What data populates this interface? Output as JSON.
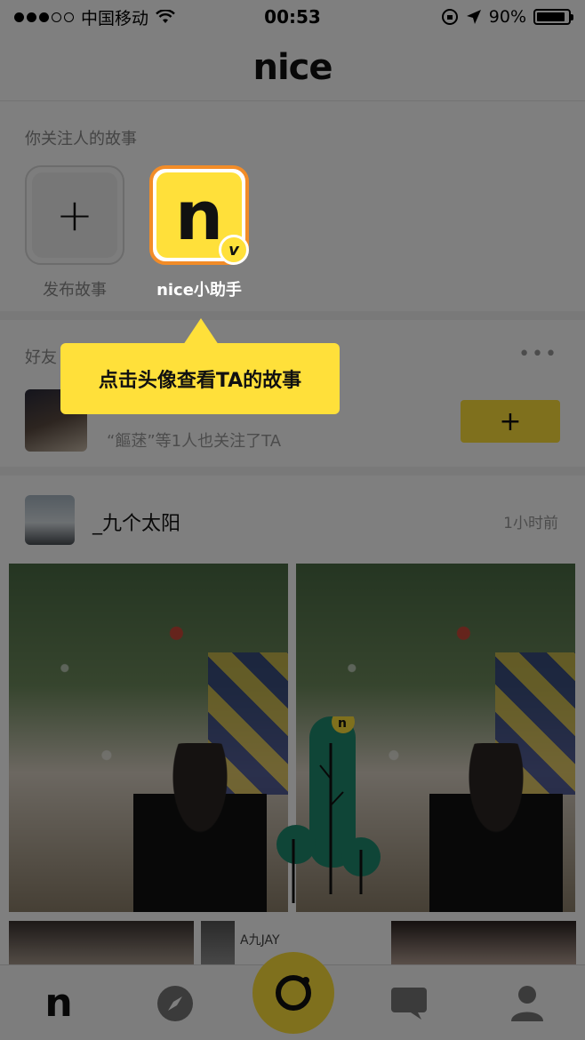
{
  "status_bar": {
    "carrier": "中国移动",
    "time": "00:53",
    "battery": "90%",
    "battery_level": 0.9
  },
  "header": {
    "logo": "nice"
  },
  "stories": {
    "title": "你关注人的故事",
    "items": [
      {
        "label": "发布故事",
        "icon": "plus-icon"
      },
      {
        "label": "nice小助手",
        "icon": "nice-logo-icon",
        "badge": "v"
      }
    ]
  },
  "friends": {
    "title": "好友",
    "more": "•••",
    "suggestion": {
      "name": "_",
      "subtitle": "“饇蒁”等1人也关注了TA",
      "follow_label": "+"
    }
  },
  "post": {
    "username": "_九个太阳",
    "time": "1小时前",
    "preview_text": "A九JAY"
  },
  "tooltip": {
    "text": "点击头像查看TA的故事"
  },
  "tab_bar": {
    "tabs": [
      {
        "name": "home",
        "icon": "nice-home-icon",
        "glyph": "n"
      },
      {
        "name": "discover",
        "icon": "compass-icon"
      },
      {
        "name": "camera",
        "icon": "camera-icon"
      },
      {
        "name": "messages",
        "icon": "chat-bubble-icon"
      },
      {
        "name": "profile",
        "icon": "person-icon"
      }
    ]
  },
  "colors": {
    "brand_yellow": "#ffe03a",
    "story_ring": "#f28c28",
    "overlay": "rgba(0,0,0,0.5)"
  }
}
